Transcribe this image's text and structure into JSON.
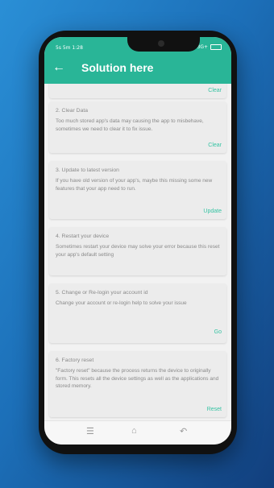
{
  "statusbar": {
    "time": "5s 5m 1:28",
    "signal": "3G+",
    "battery": ""
  },
  "appbar": {
    "title": "Solution here",
    "back_icon": "arrow-left-icon"
  },
  "cards": [
    {
      "title": "",
      "desc": "",
      "action": "Clear"
    },
    {
      "title": "2. Clear Data",
      "desc": "Too much stored app's data may causing the app to misbehave, sometimes we need to clear it to fix issue.",
      "action": "Clear"
    },
    {
      "title": "3. Update to latest version",
      "desc": "If you have old version of your app's, maybe this missing some new features that your app need to run.",
      "action": "Update"
    },
    {
      "title": "4. Restart your device",
      "desc": "Sometimes restart your device may solve your error because this reset your app's default setting",
      "action": ""
    },
    {
      "title": "5. Change or Re-login your account id",
      "desc": "Change your account or re-login help to solve your issue",
      "action": "Go"
    },
    {
      "title": "6. Factory reset",
      "desc": "\"Factory reset\" because the process returns the device to originally form. This resets all the device settings as well as the applications and stored memory.",
      "action": "Reset"
    }
  ],
  "navbar": {
    "menu_icon": "menu-icon",
    "home_icon": "home-icon",
    "back_icon": "back-icon"
  },
  "colors": {
    "accent": "#29b597",
    "action": "#36c3a3"
  }
}
